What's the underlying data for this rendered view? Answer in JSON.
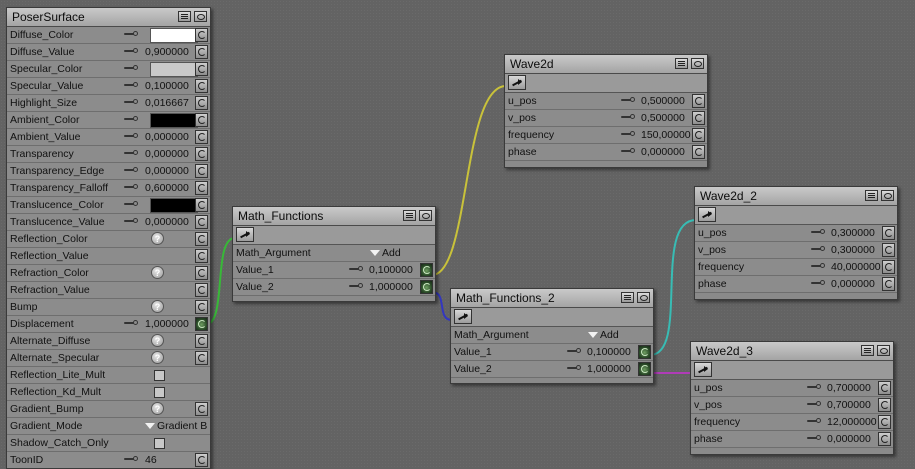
{
  "colors": {
    "diffuse_swatch": "#ffffff",
    "specular_swatch": "#c9c9c9",
    "ambient_swatch": "#000000",
    "translucence_swatch": "#000000"
  },
  "poser_surface": {
    "title": "PoserSurface",
    "rows": [
      {
        "label": "Diffuse_Color",
        "kind": "color",
        "swatch": "#ffffff"
      },
      {
        "label": "Diffuse_Value",
        "kind": "value",
        "value": "0,900000"
      },
      {
        "label": "Specular_Color",
        "kind": "color",
        "swatch": "#c9c9c9"
      },
      {
        "label": "Specular_Value",
        "kind": "value",
        "value": "0,100000"
      },
      {
        "label": "Highlight_Size",
        "kind": "value",
        "value": "0,016667"
      },
      {
        "label": "Ambient_Color",
        "kind": "color",
        "swatch": "#000000"
      },
      {
        "label": "Ambient_Value",
        "kind": "value",
        "value": "0,000000"
      },
      {
        "label": "Transparency",
        "kind": "value",
        "value": "0,000000"
      },
      {
        "label": "Transparency_Edge",
        "kind": "value",
        "value": "0,000000"
      },
      {
        "label": "Transparency_Falloff",
        "kind": "value",
        "value": "0,600000"
      },
      {
        "label": "Translucence_Color",
        "kind": "color",
        "swatch": "#000000"
      },
      {
        "label": "Translucence_Value",
        "kind": "value",
        "value": "0,000000"
      },
      {
        "label": "Reflection_Color",
        "kind": "help"
      },
      {
        "label": "Reflection_Value",
        "kind": "plug"
      },
      {
        "label": "Refraction_Color",
        "kind": "help"
      },
      {
        "label": "Refraction_Value",
        "kind": "plug"
      },
      {
        "label": "Bump",
        "kind": "help"
      },
      {
        "label": "Displacement",
        "kind": "value",
        "value": "1,000000",
        "connected": true
      },
      {
        "label": "Alternate_Diffuse",
        "kind": "help"
      },
      {
        "label": "Alternate_Specular",
        "kind": "help"
      },
      {
        "label": "Reflection_Lite_Mult",
        "kind": "check"
      },
      {
        "label": "Reflection_Kd_Mult",
        "kind": "check"
      },
      {
        "label": "Gradient_Bump",
        "kind": "help"
      },
      {
        "label": "Gradient_Mode",
        "kind": "menu",
        "value": "Gradient B"
      },
      {
        "label": "Shadow_Catch_Only",
        "kind": "check"
      },
      {
        "label": "ToonID",
        "kind": "value",
        "value": "46"
      }
    ]
  },
  "math_functions": {
    "title": "Math_Functions",
    "argument_label": "Math_Argument",
    "argument_value": "Add",
    "value_1": "0,100000",
    "value_2": "1,000000",
    "value_1_label": "Value_1",
    "value_2_label": "Value_2"
  },
  "math_functions_2": {
    "title": "Math_Functions_2",
    "argument_label": "Math_Argument",
    "argument_value": "Add",
    "value_1": "0,100000",
    "value_2": "1,000000",
    "value_1_label": "Value_1",
    "value_2_label": "Value_2"
  },
  "wave2d": {
    "title": "Wave2d",
    "u_pos_label": "u_pos",
    "u_pos": "0,500000",
    "v_pos_label": "v_pos",
    "v_pos": "0,500000",
    "frequency_label": "frequency",
    "frequency": "150,00000",
    "phase_label": "phase",
    "phase": "0,000000"
  },
  "wave2d_2": {
    "title": "Wave2d_2",
    "u_pos_label": "u_pos",
    "u_pos": "0,300000",
    "v_pos_label": "v_pos",
    "v_pos": "0,300000",
    "frequency_label": "frequency",
    "frequency": "40,000000",
    "phase_label": "phase",
    "phase": "0,000000"
  },
  "wave2d_3": {
    "title": "Wave2d_3",
    "u_pos_label": "u_pos",
    "u_pos": "0,700000",
    "v_pos_label": "v_pos",
    "v_pos": "0,700000",
    "frequency_label": "frequency",
    "frequency": "12,000000",
    "phase_label": "phase",
    "phase": "0,000000"
  },
  "wires": [
    {
      "name": "displacement-wire",
      "color": "#38b838"
    },
    {
      "name": "wave2d-wire",
      "color": "#c9c23a"
    },
    {
      "name": "math2-wire",
      "color": "#3337c0"
    },
    {
      "name": "wave2d-2-wire",
      "color": "#38bcb4"
    },
    {
      "name": "wave2d-3-wire",
      "color": "#b03cb8"
    }
  ]
}
